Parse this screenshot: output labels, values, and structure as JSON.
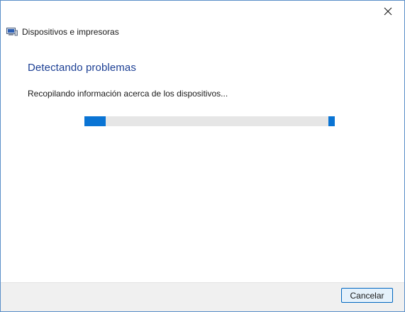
{
  "window": {
    "header_title": "Dispositivos e impresoras",
    "close_icon": "close-icon",
    "app_icon": "devices-printers-icon"
  },
  "main": {
    "heading": "Detectando problemas",
    "status": "Recopilando información acerca de los dispositivos...",
    "progress": {
      "type": "indeterminate",
      "accent": "#0a74d4",
      "track": "#e6e6e6"
    }
  },
  "footer": {
    "cancel_label": "Cancelar"
  },
  "colors": {
    "heading": "#1c3f94",
    "border": "#5b8fc9",
    "footer_bg": "#f0f0f0",
    "button_border": "#0067c0"
  }
}
